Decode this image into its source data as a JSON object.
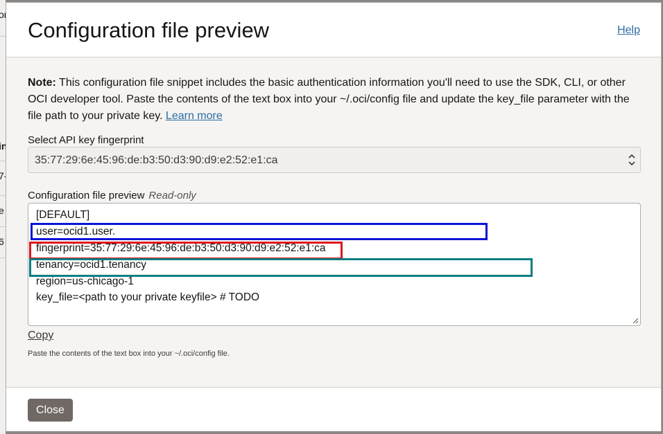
{
  "background": {
    "fragments": [
      "or",
      "in",
      "7-",
      "e",
      "6"
    ]
  },
  "dialog": {
    "title": "Configuration file preview",
    "help_link": "Help",
    "note": {
      "bold": "Note:",
      "text": " This configuration file snippet includes the basic authentication information you'll need to use the SDK, CLI, or other OCI developer tool. Paste the contents of the text box into your ~/.oci/config file and update the key_file parameter with the file path to your private key. ",
      "link": "Learn more"
    },
    "fingerprint_select": {
      "label": "Select API key fingerprint",
      "value": "35:77:29:6e:45:96:de:b3:50:d3:90:d9:e2:52:e1:ca"
    },
    "config_preview": {
      "label": "Configuration file preview",
      "readonly_label": "Read-only",
      "lines": [
        "[DEFAULT]",
        "user=ocid1.user.",
        "fingerprint=35:77:29:6e:45:96:de:b3:50:d3:90:d9:e2:52:e1:ca",
        "tenancy=ocid1.tenancy",
        "region=us-chicago-1",
        "key_file=<path to your private keyfile> # TODO"
      ]
    },
    "copy_link": "Copy",
    "hint": "Paste the contents of the text box into your ~/.oci/config file.",
    "close_button": "Close"
  },
  "colors": {
    "highlight_user": "#0a14d6",
    "highlight_fingerprint": "#e0141e",
    "highlight_tenancy": "#0a7f82",
    "link": "#2b6ca3",
    "close_button_bg": "#6f6864"
  },
  "icons": {
    "select": "chevron-up-down-icon",
    "textarea": "resize-grip-icon"
  }
}
